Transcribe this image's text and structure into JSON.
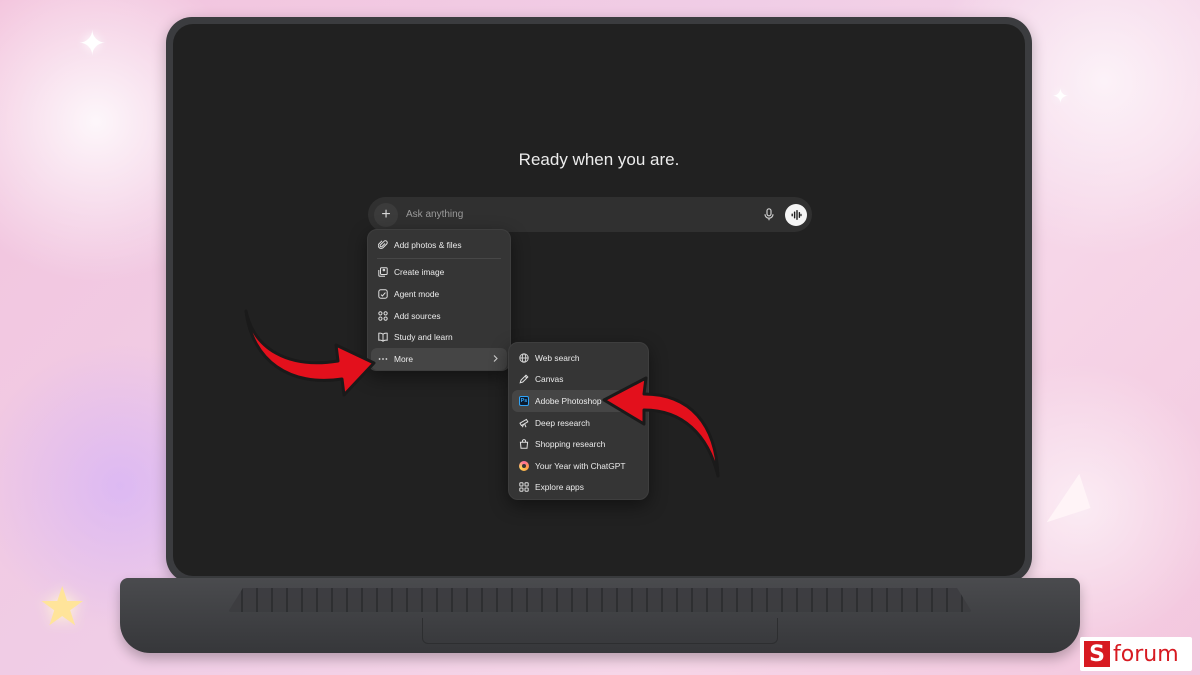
{
  "screen": {
    "headline": "Ready when you are.",
    "prompt": {
      "placeholder": "Ask anything",
      "plus_icon": "plus-icon",
      "mic_icon": "mic-icon",
      "voice_icon": "voice-waveform-icon"
    }
  },
  "attach_menu": {
    "items": [
      {
        "label": "Add photos & files",
        "icon": "paperclip-icon"
      },
      {
        "label": "Create image",
        "icon": "image-icon"
      },
      {
        "label": "Agent mode",
        "icon": "agent-icon"
      },
      {
        "label": "Add sources",
        "icon": "sources-icon"
      },
      {
        "label": "Study and learn",
        "icon": "book-icon"
      },
      {
        "label": "More",
        "icon": "ellipsis-icon",
        "has_submenu": true
      }
    ]
  },
  "more_menu": {
    "items": [
      {
        "label": "Web search",
        "icon": "globe-icon"
      },
      {
        "label": "Canvas",
        "icon": "canvas-pen-icon"
      },
      {
        "label": "Adobe Photoshop",
        "icon": "photoshop-icon",
        "icon_text": "Ps"
      },
      {
        "label": "Deep research",
        "icon": "telescope-icon"
      },
      {
        "label": "Shopping research",
        "icon": "shopping-bag-icon"
      },
      {
        "label": "Your Year with ChatGPT",
        "icon": "year-ring-icon"
      },
      {
        "label": "Explore apps",
        "icon": "apps-grid-icon"
      }
    ]
  },
  "watermark": {
    "badge": "S",
    "text": "forum"
  },
  "colors": {
    "screen_bg": "#212121",
    "menu_bg": "#353535",
    "highlight_arrow": "#e3101c",
    "brand_red": "#d71a21"
  }
}
